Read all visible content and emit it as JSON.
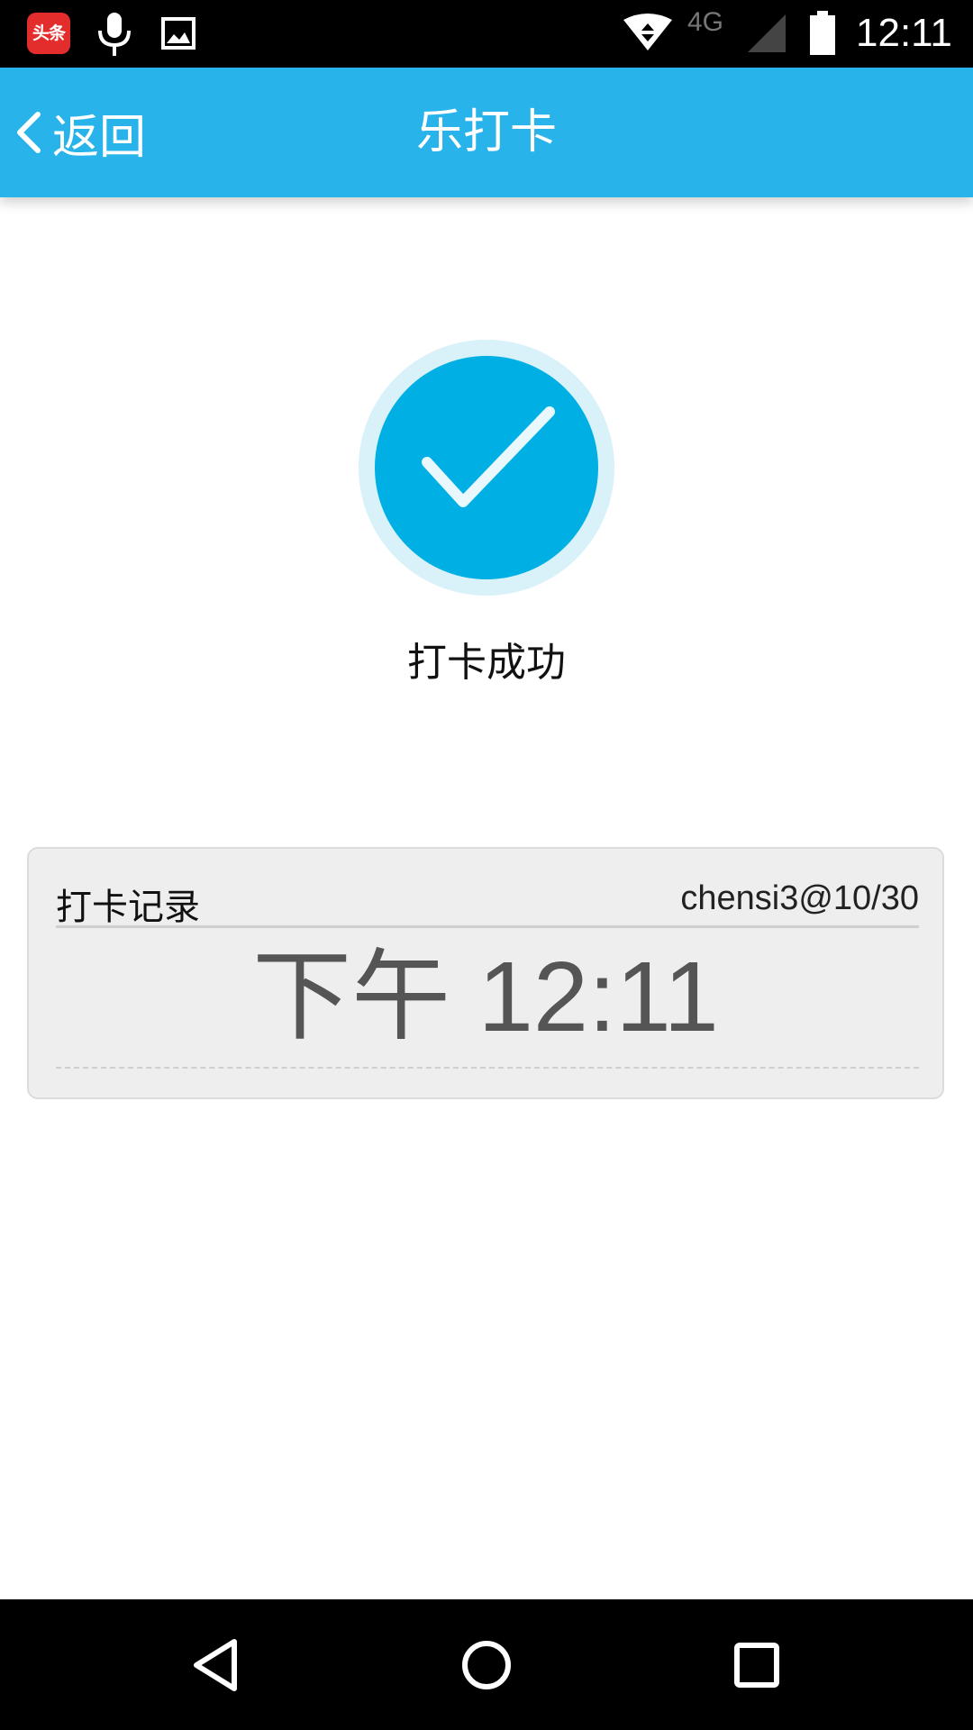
{
  "status_bar": {
    "app_icon_text": "头条",
    "network": "4G",
    "time": "12:11"
  },
  "title_bar": {
    "back_label": "返回",
    "title": "乐打卡"
  },
  "result": {
    "status_text": "打卡成功",
    "accent_color": "#00b0e4"
  },
  "record": {
    "title": "打卡记录",
    "user": "chensi3@10/30",
    "time": "下午 12:11"
  },
  "nav_bar": {
    "back_icon": "back-triangle-icon",
    "home_icon": "home-circle-icon",
    "recents_icon": "recents-square-icon"
  }
}
